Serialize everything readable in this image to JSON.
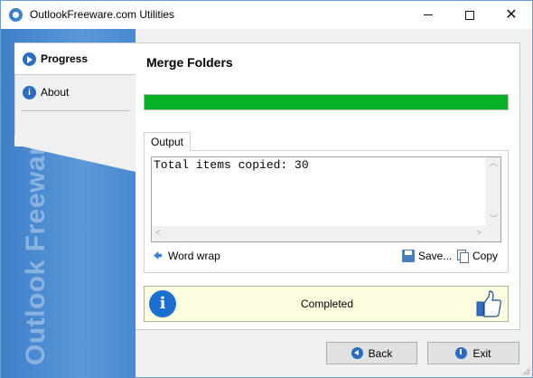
{
  "window": {
    "title": "OutlookFreeware.com Utilities",
    "controls": {
      "minimize": "minimize-icon",
      "maximize": "maximize-icon",
      "close": "close-icon"
    }
  },
  "sidebar": {
    "items": [
      {
        "label": "Progress",
        "icon": "play-icon",
        "active": true
      },
      {
        "label": "About",
        "icon": "info-icon",
        "active": false
      }
    ],
    "watermark": "Outlook Freeware .com"
  },
  "main": {
    "heading": "Merge Folders",
    "progress_fraction": 1.0,
    "progress_color": "#06b025",
    "output_tab": "Output",
    "output_text": "Total items copied: 30",
    "toolbar": {
      "word_wrap": "Word wrap",
      "save": "Save...",
      "copy": "Copy"
    },
    "status": {
      "text": "Completed",
      "icon": "info-icon",
      "badge": "thumbs-up-icon"
    }
  },
  "footer": {
    "back": "Back",
    "exit": "Exit"
  }
}
